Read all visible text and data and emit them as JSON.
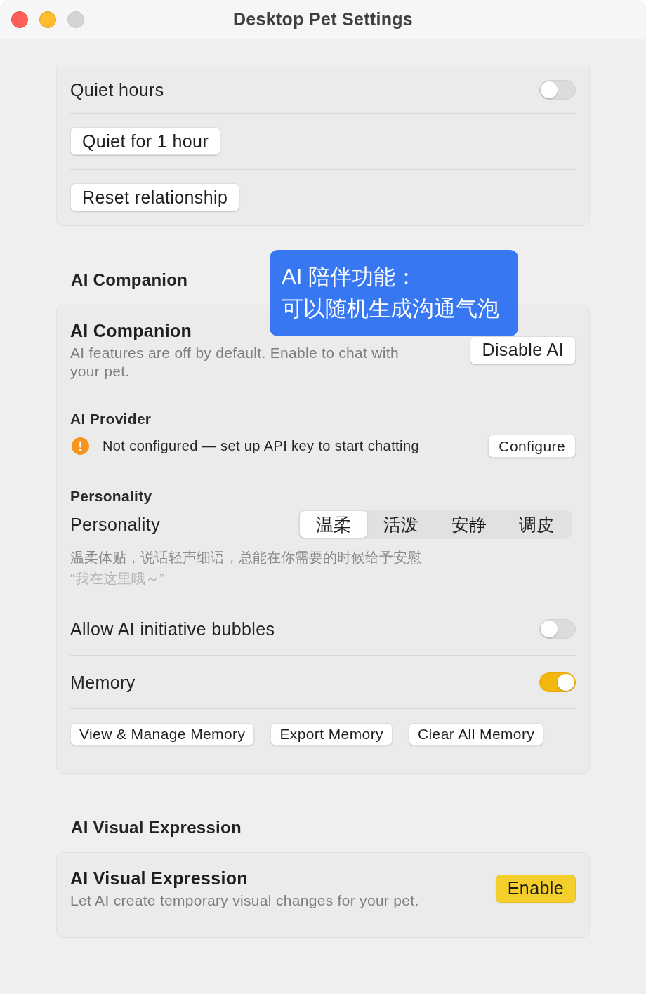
{
  "window": {
    "title": "Desktop Pet Settings",
    "buttons": [
      {
        "kind": "close",
        "disabled": false
      },
      {
        "kind": "minimize",
        "disabled": false
      },
      {
        "kind": "zoom",
        "disabled": true
      }
    ]
  },
  "sections": [
    {
      "rows": [
        {
          "kind": "toggle",
          "label": "Quiet hours",
          "on": false
        },
        {
          "kind": "button",
          "label": "Quiet for 1 hour"
        },
        {
          "kind": "button",
          "label": "Reset relationship"
        }
      ]
    },
    {
      "heading": "AI Companion",
      "rows": [
        {
          "kind": "header",
          "title": "AI Companion",
          "subtitle": "AI features are off by default. Enable to chat with your pet.",
          "button": {
            "label": "Disable AI",
            "primary": false
          }
        },
        {
          "kind": "status",
          "title": "AI Provider",
          "warning": true,
          "status": "Not configured — set up API key to start chatting",
          "button": {
            "label": "Configure",
            "primary": false
          }
        },
        {
          "kind": "segmented",
          "title": "Personality",
          "label": "Personality",
          "options": [
            {
              "label": "温柔",
              "selected": true
            },
            {
              "label": "活泼",
              "selected": false
            },
            {
              "label": "安静",
              "selected": false
            },
            {
              "label": "调皮",
              "selected": false
            }
          ],
          "description": "温柔体贴，说话轻声细语，总能在你需要的时候给予安慰",
          "quote": "“我在这里哦～”"
        },
        {
          "kind": "toggle",
          "label": "Allow AI initiative bubbles",
          "on": false
        },
        {
          "kind": "toggle",
          "label": "Memory",
          "on": true
        },
        {
          "kind": "buttons",
          "buttons": [
            {
              "label": "View & Manage Memory",
              "primary": false
            },
            {
              "label": "Export Memory",
              "primary": false
            },
            {
              "label": "Clear All Memory",
              "primary": false
            }
          ]
        }
      ]
    },
    {
      "heading": "AI Visual Expression",
      "rows": [
        {
          "kind": "header",
          "title": "AI Visual Expression",
          "subtitle": "Let AI create temporary visual changes for your pet.",
          "button": {
            "label": "Enable",
            "primary": true
          }
        }
      ]
    }
  ],
  "annotation": {
    "lines": [
      "AI 陪伴功能：",
      "可以随机生成沟通气泡"
    ]
  }
}
